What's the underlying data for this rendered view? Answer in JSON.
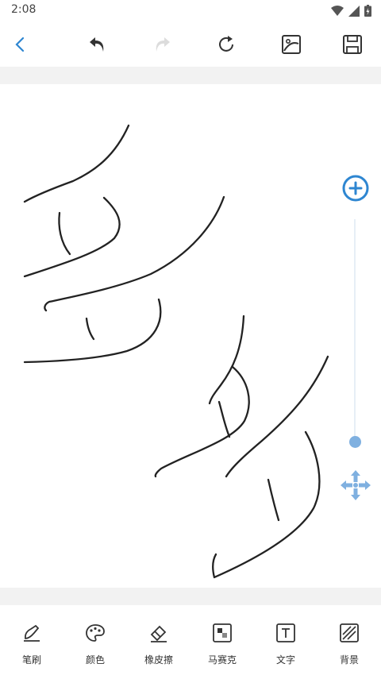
{
  "status": {
    "time": "2:08"
  },
  "toolbar": {
    "back": "back-icon",
    "undo": "undo-icon",
    "redo": "redo-icon",
    "refresh": "refresh-icon",
    "image": "image-icon",
    "save": "save-icon"
  },
  "tools": [
    {
      "label": "笔刷",
      "icon": "brush-icon"
    },
    {
      "label": "颜色",
      "icon": "palette-icon"
    },
    {
      "label": "橡皮擦",
      "icon": "eraser-icon"
    },
    {
      "label": "马赛克",
      "icon": "mosaic-icon"
    },
    {
      "label": "文字",
      "icon": "text-icon"
    },
    {
      "label": "背景",
      "icon": "background-icon"
    }
  ],
  "colors": {
    "accent": "#2e86d1",
    "zoom": "#7fb0e0",
    "stroke": "#222222"
  }
}
